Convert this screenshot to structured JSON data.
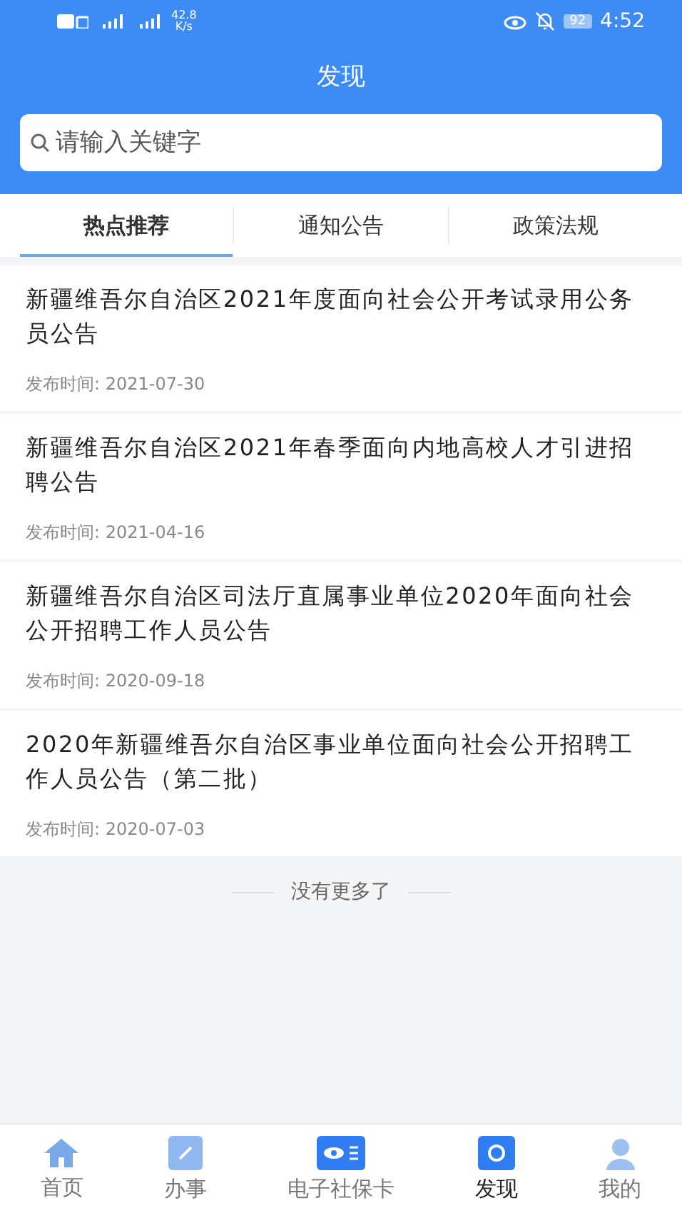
{
  "status_bar": {
    "speed": "42.8",
    "speed_unit": "K/s",
    "battery": "92",
    "time": "4:52"
  },
  "header": {
    "title": "发现"
  },
  "search": {
    "placeholder": "请输入关键字"
  },
  "tabs": [
    {
      "label": "热点推荐",
      "selected": true
    },
    {
      "label": "通知公告",
      "selected": false
    },
    {
      "label": "政策法规",
      "selected": false
    }
  ],
  "articles": [
    {
      "title": "新疆维吾尔自治区2021年度面向社会公开考试录用公务员公告",
      "date": "发布时间: 2021-07-30"
    },
    {
      "title": "新疆维吾尔自治区2021年春季面向内地高校人才引进招聘公告",
      "date": "发布时间: 2021-04-16"
    },
    {
      "title": "新疆维吾尔自治区司法厅直属事业单位2020年面向社会公开招聘工作人员公告",
      "date": "发布时间: 2020-09-18"
    },
    {
      "title": "2020年新疆维吾尔自治区事业单位面向社会公开招聘工作人员公告（第二批）",
      "date": "发布时间: 2020-07-03"
    }
  ],
  "end_note": "没有更多了",
  "nav": [
    {
      "label": "首页",
      "kind": "home",
      "selected": false
    },
    {
      "label": "办事",
      "kind": "edit",
      "selected": false
    },
    {
      "label": "电子社保卡",
      "kind": "card",
      "selected": false
    },
    {
      "label": "发现",
      "kind": "discover",
      "selected": true
    },
    {
      "label": "我的",
      "kind": "user",
      "selected": false
    }
  ]
}
